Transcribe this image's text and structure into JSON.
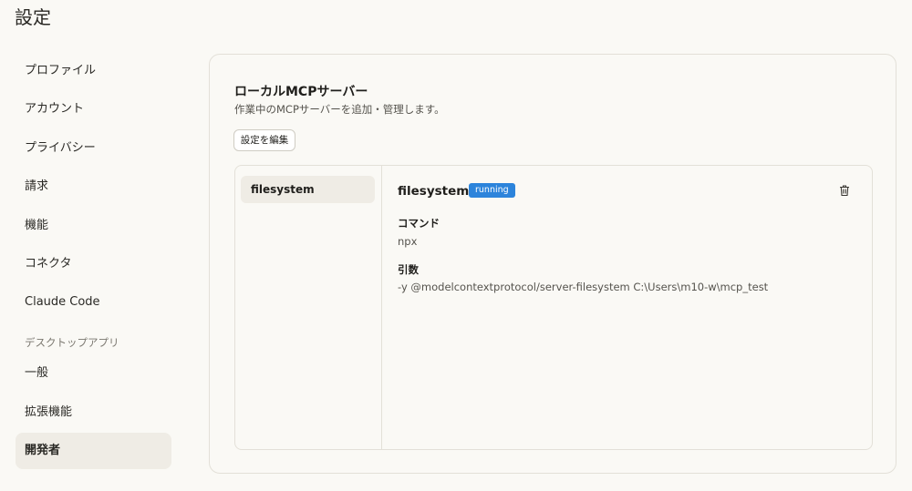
{
  "page": {
    "title": "設定"
  },
  "sidebar": {
    "items": [
      {
        "label": "プロファイル"
      },
      {
        "label": "アカウント"
      },
      {
        "label": "プライバシー"
      },
      {
        "label": "請求"
      },
      {
        "label": "機能"
      },
      {
        "label": "コネクタ"
      },
      {
        "label": "Claude Code"
      }
    ],
    "section_label": "デスクトップアプリ",
    "desktop_items": [
      {
        "label": "一般"
      },
      {
        "label": "拡張機能"
      },
      {
        "label": "開発者",
        "active": true
      }
    ]
  },
  "main": {
    "title": "ローカルMCPサーバー",
    "description": "作業中のMCPサーバーを追加・管理します。",
    "edit_button": "設定を編集",
    "servers": [
      {
        "name": "filesystem"
      }
    ],
    "detail": {
      "name": "filesystem",
      "status": "running",
      "status_color": "#2c84db",
      "command_label": "コマンド",
      "command_value": "npx",
      "args_label": "引数",
      "args_value": "-y @modelcontextprotocol/server-filesystem C:\\Users\\m10-w\\mcp_test",
      "delete_icon": "trash-icon"
    }
  }
}
